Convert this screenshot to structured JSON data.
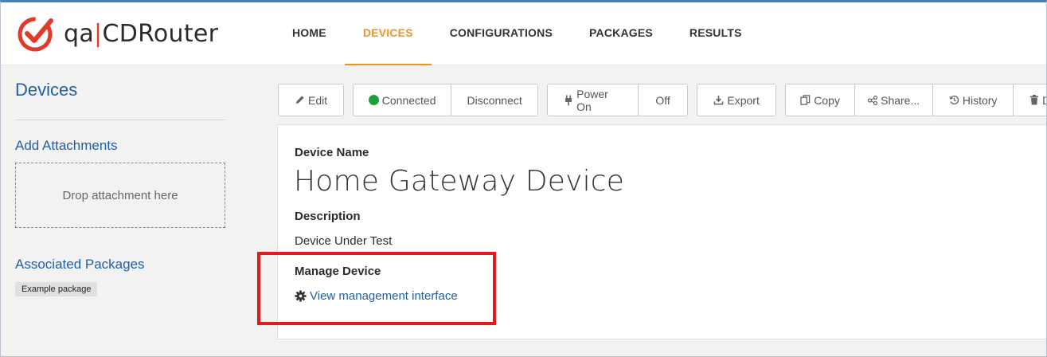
{
  "brand": {
    "prefix": "qa",
    "separator": "|",
    "name": "CDRouter",
    "accent": "#e23a2a"
  },
  "nav": {
    "items": [
      {
        "label": "HOME"
      },
      {
        "label": "DEVICES"
      },
      {
        "label": "CONFIGURATIONS"
      },
      {
        "label": "PACKAGES"
      },
      {
        "label": "RESULTS"
      }
    ],
    "active": "DEVICES",
    "active_color": "#f0941f"
  },
  "sidebar": {
    "title": "Devices",
    "attachments_heading": "Add Attachments",
    "dropzone_text": "Drop attachment here",
    "packages_heading": "Associated Packages",
    "packages": [
      "Example package"
    ]
  },
  "toolbar": {
    "edit": {
      "label": "Edit",
      "icon": "pencil-icon"
    },
    "connected": {
      "label": "Connected",
      "icon": "green-dot-icon",
      "color": "#1aa13a"
    },
    "disconnect": {
      "label": "Disconnect"
    },
    "power_on": {
      "label": "Power On",
      "icon": "plug-icon"
    },
    "off": {
      "label": "Off"
    },
    "export": {
      "label": "Export",
      "icon": "download-icon"
    },
    "copy": {
      "label": "Copy",
      "icon": "copy-icon"
    },
    "share": {
      "label": "Share...",
      "icon": "share-icon"
    },
    "history": {
      "label": "History",
      "icon": "history-icon"
    },
    "delete": {
      "label": "D",
      "icon": "trash-icon"
    }
  },
  "device": {
    "name_label": "Device Name",
    "name": "Home Gateway Device",
    "description_label": "Description",
    "description": "Device Under Test",
    "manage_label": "Manage Device",
    "manage_link": "View management interface",
    "manage_icon": "gear-icon"
  },
  "highlight_color": "#e01b1b"
}
